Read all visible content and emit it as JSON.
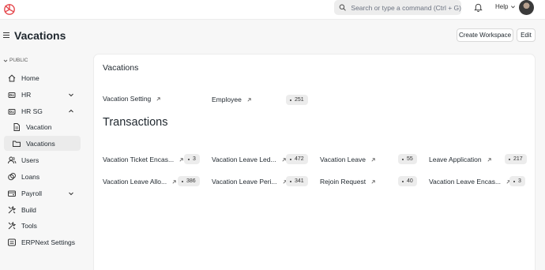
{
  "navbar": {
    "search_placeholder": "Search or type a command (Ctrl + G)",
    "help_label": "Help"
  },
  "header": {
    "title": "Vacations",
    "create_workspace_label": "Create Workspace",
    "edit_label": "Edit"
  },
  "sidebar": {
    "section_label": "PUBLIC",
    "items": [
      {
        "label": "Home",
        "icon": "home-icon"
      },
      {
        "label": "HR",
        "icon": "hr-icon"
      },
      {
        "label": "HR SG",
        "icon": "hr-sg-icon"
      },
      {
        "label": "Vacation",
        "icon": "file-icon"
      },
      {
        "label": "Vacations",
        "icon": "folder-icon"
      },
      {
        "label": "Users",
        "icon": "users-icon"
      },
      {
        "label": "Loans",
        "icon": "loans-icon"
      },
      {
        "label": "Payroll",
        "icon": "payroll-icon"
      },
      {
        "label": "Build",
        "icon": "tools-icon"
      },
      {
        "label": "Tools",
        "icon": "tools-icon"
      },
      {
        "label": "ERPNext Settings",
        "icon": "settings-icon"
      }
    ]
  },
  "main": {
    "card_title": "Vacations",
    "shortcuts": [
      {
        "label": "Vacation Setting",
        "count": null
      },
      {
        "label": "Employee",
        "count": "251"
      }
    ],
    "transactions_title": "Transactions",
    "transactions": [
      {
        "label": "Vacation Ticket Encas...",
        "count": "3"
      },
      {
        "label": "Vacation Leave Led...",
        "count": "472"
      },
      {
        "label": "Vacation Leave",
        "count": "55"
      },
      {
        "label": "Leave Application",
        "count": "217"
      },
      {
        "label": "Vacation Leave Allo...",
        "count": "386"
      },
      {
        "label": "Vacation Leave Peri...",
        "count": "341"
      },
      {
        "label": "Rejoin Request",
        "count": "40"
      },
      {
        "label": "Vacation Leave Encas...",
        "count": "3"
      }
    ]
  },
  "colors": {
    "brand": "#e5484d",
    "text": "#1f272e",
    "active_bg": "#ebebeb",
    "badge_bg": "#ececec"
  }
}
